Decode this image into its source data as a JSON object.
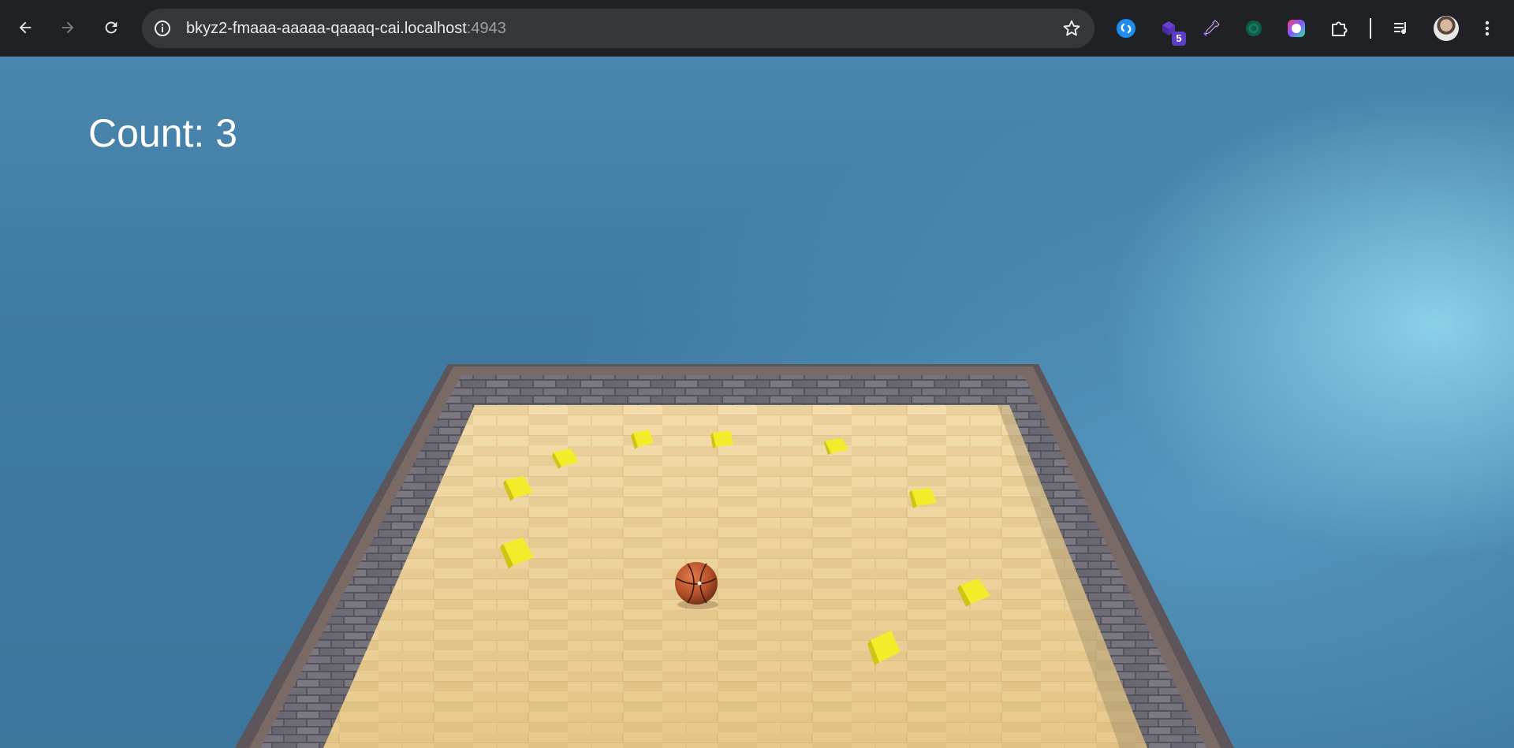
{
  "browser": {
    "url_host": "bkyz2-fmaaa-aaaaa-qaaaq-cai.localhost",
    "url_port": ":4943",
    "extensions": [
      {
        "name": "shazam-icon",
        "badge": ""
      },
      {
        "name": "purple-extension-icon",
        "badge": "5"
      },
      {
        "name": "eyedropper-icon",
        "badge": ""
      },
      {
        "name": "green-extension-icon",
        "badge": ""
      },
      {
        "name": "color-ring-extension-icon",
        "badge": ""
      },
      {
        "name": "puzzle-extensions-icon",
        "badge": ""
      }
    ]
  },
  "game": {
    "hud": {
      "count_label": "Count: 3",
      "count_value": 3
    },
    "pickups_remaining": 10,
    "colors": {
      "sky_top": "#4a86ad",
      "floor_light": "#efd8a4",
      "floor_dark": "#d9b77a",
      "wall": "#5d5a63",
      "wall_rim": "#6c5f5b",
      "pickup": "#f3ec2a",
      "ball": "#b8542a"
    }
  }
}
